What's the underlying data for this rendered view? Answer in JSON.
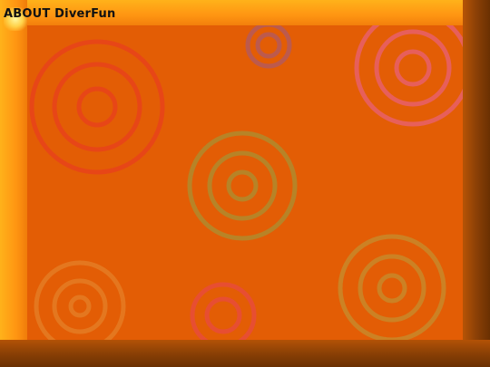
{
  "window": {
    "title": "ABOUT DiverFun"
  },
  "colors": {
    "frame_light": "#ff9512",
    "frame_dark": "#6a3002",
    "panel": "#e35d05"
  },
  "decorations": [
    {
      "name": "ring-target-red-large",
      "color": "#e8441a"
    },
    {
      "name": "ring-target-mauve-small",
      "color": "#b85a55"
    },
    {
      "name": "ring-target-pink-large",
      "color": "#e8606a"
    },
    {
      "name": "ring-target-olive-center",
      "color": "#b08a2e"
    },
    {
      "name": "ring-target-orange-bottom-left",
      "color": "#e5822a"
    },
    {
      "name": "ring-target-red-bottom",
      "color": "#e84c3a"
    },
    {
      "name": "ring-target-olive-bottom-right",
      "color": "#c8882a"
    }
  ]
}
